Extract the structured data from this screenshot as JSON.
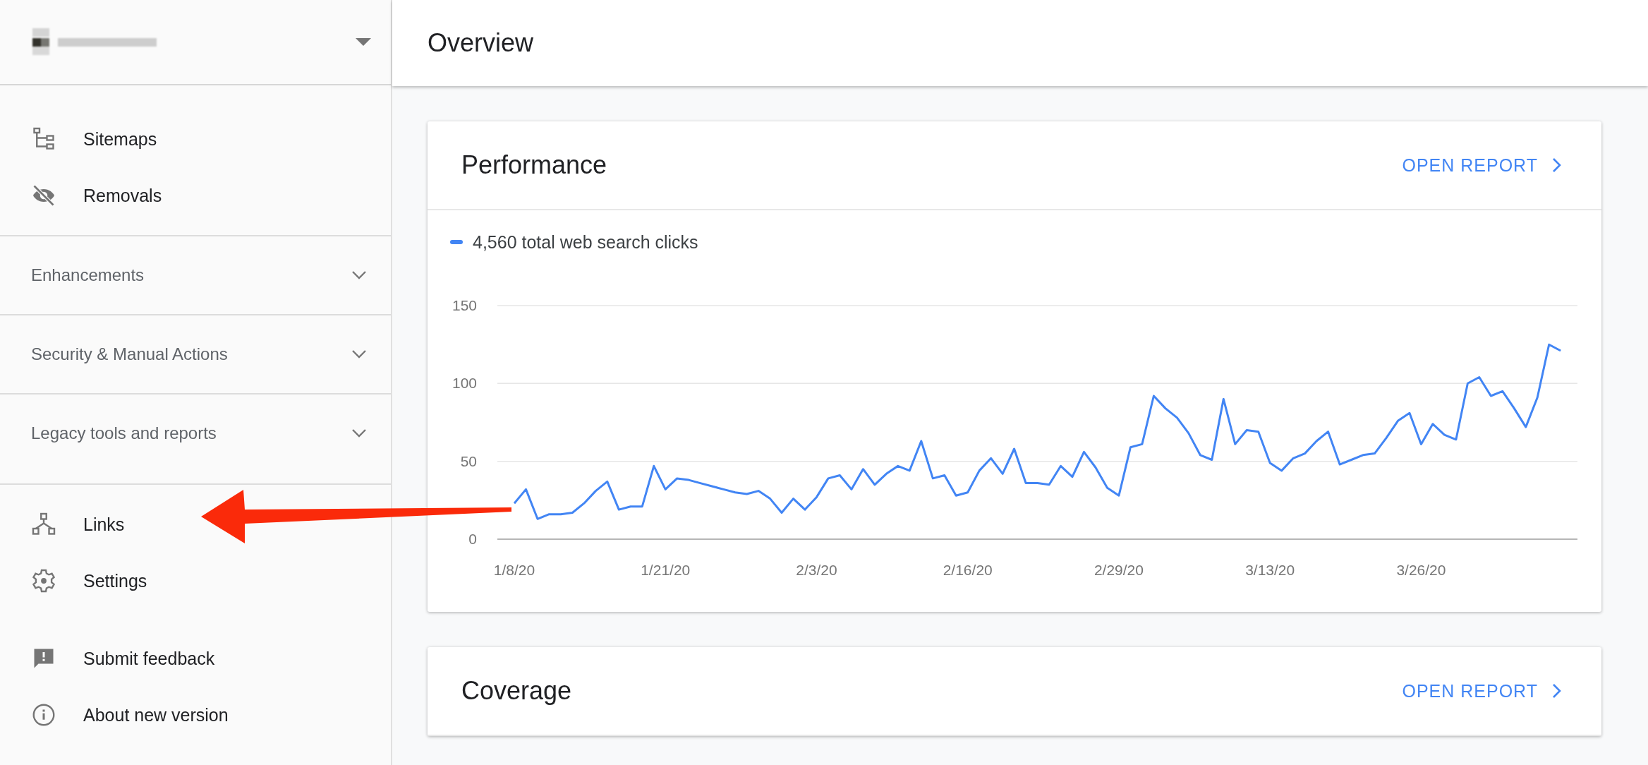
{
  "header": {
    "title": "Overview"
  },
  "sidebar": {
    "items": [
      {
        "kind": "link",
        "label": "Sitemaps"
      },
      {
        "kind": "link",
        "label": "Removals"
      },
      {
        "kind": "section",
        "label": "Enhancements",
        "expanded": false
      },
      {
        "kind": "section",
        "label": "Security & Manual Actions",
        "expanded": false
      },
      {
        "kind": "section",
        "label": "Legacy tools and reports",
        "expanded": false
      },
      {
        "kind": "link",
        "label": "Links"
      },
      {
        "kind": "link",
        "label": "Settings"
      },
      {
        "kind": "gap"
      },
      {
        "kind": "link",
        "label": "Submit feedback"
      },
      {
        "kind": "link",
        "label": "About new version"
      }
    ]
  },
  "cards": [
    {
      "title": "Performance",
      "action": "OPEN REPORT",
      "legend": "4,560 total web search clicks",
      "chart_data": {
        "type": "line",
        "categories": [
          "1/8/20",
          null,
          null,
          null,
          null,
          null,
          null,
          null,
          null,
          null,
          null,
          null,
          null,
          "1/21/20",
          null,
          null,
          null,
          null,
          null,
          null,
          null,
          null,
          null,
          null,
          null,
          null,
          "2/3/20",
          null,
          null,
          null,
          null,
          null,
          null,
          null,
          null,
          null,
          null,
          null,
          null,
          "2/16/20",
          null,
          null,
          null,
          null,
          null,
          null,
          null,
          null,
          null,
          null,
          null,
          null,
          "2/29/20",
          null,
          null,
          null,
          null,
          null,
          null,
          null,
          null,
          null,
          null,
          null,
          null,
          "3/13/20",
          null,
          null,
          null,
          null,
          null,
          null,
          null,
          null,
          null,
          null,
          null,
          null,
          "3/26/20",
          null,
          null,
          null,
          null,
          null,
          null,
          null,
          null,
          null,
          null,
          null,
          null
        ],
        "series": [
          {
            "color": "#4285f4",
            "values": [
              23,
              32,
              13,
              16,
              16,
              17,
              23,
              31,
              37,
              19,
              21,
              21,
              47,
              32,
              39,
              38,
              36,
              34,
              32,
              30,
              29,
              31,
              26,
              17,
              26,
              19,
              27,
              39,
              41,
              32,
              45,
              35,
              42,
              47,
              44,
              63,
              39,
              41,
              28,
              30,
              44,
              52,
              42,
              58,
              36,
              36,
              35,
              47,
              40,
              56,
              46,
              33,
              28,
              59,
              61,
              92,
              84,
              78,
              68,
              54,
              51,
              90,
              61,
              70,
              69,
              49,
              44,
              52,
              55,
              63,
              69,
              48,
              51,
              54,
              55,
              65,
              76,
              81,
              61,
              74,
              67,
              64,
              100,
              104,
              92,
              95,
              84,
              72,
              91,
              125,
              121
            ]
          }
        ],
        "ylim": [
          0,
          150
        ],
        "yticks": [
          0,
          50,
          100,
          150
        ]
      }
    },
    {
      "title": "Coverage",
      "action": "OPEN REPORT"
    }
  ]
}
